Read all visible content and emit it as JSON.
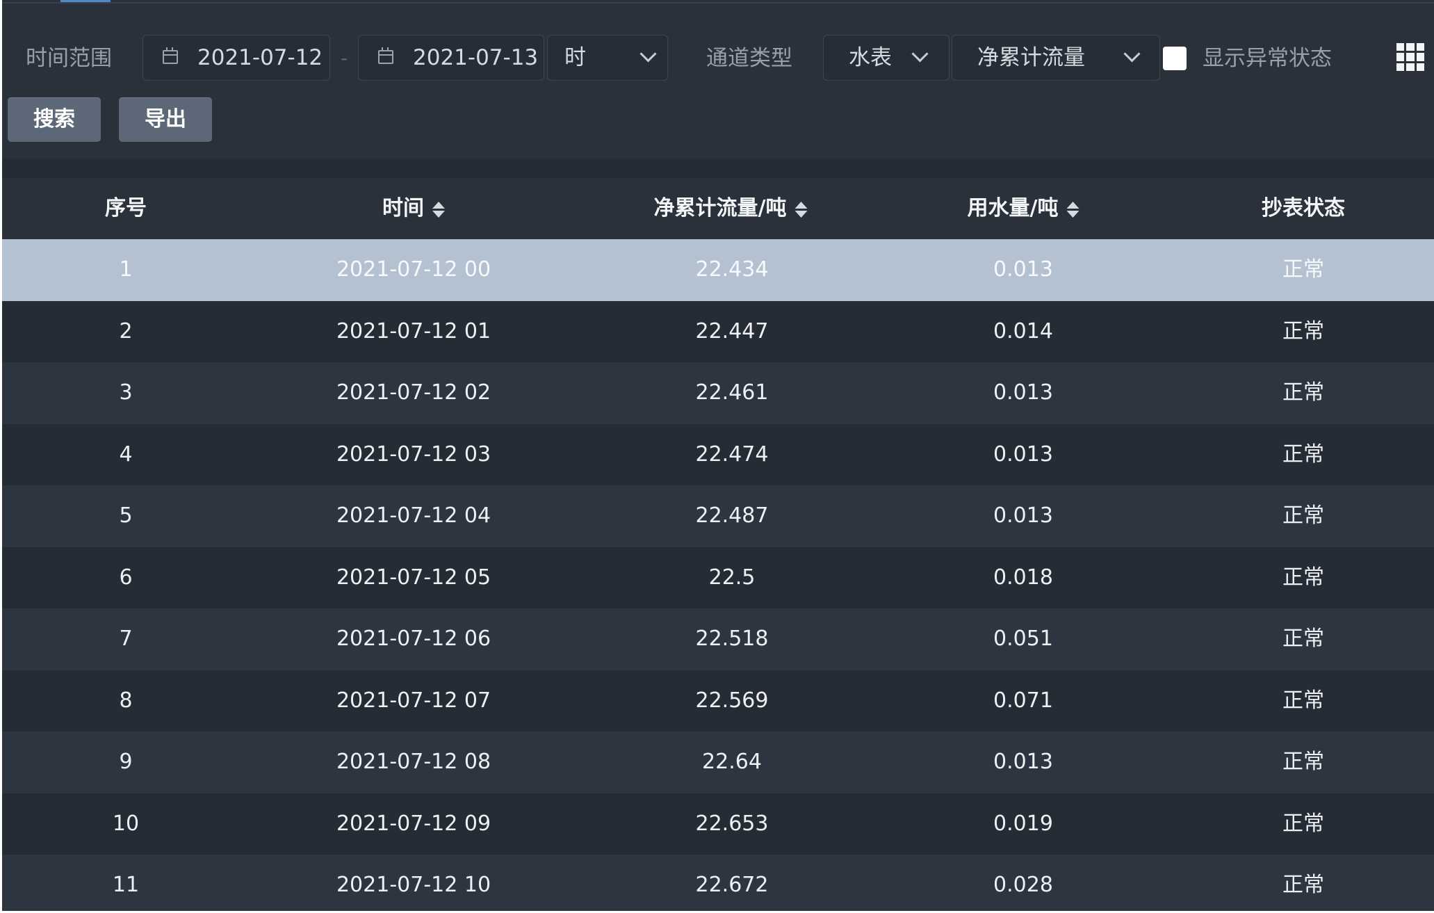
{
  "filters": {
    "time_range_label": "时间范围",
    "start_date": "2021-07-12",
    "separator": "-",
    "end_date": "2021-07-13",
    "granularity": "时",
    "channel_type_label": "通道类型",
    "channel_type": "水表",
    "metric": "净累计流量",
    "show_abnormal_label": "显示异常状态",
    "show_abnormal_checked": false
  },
  "buttons": {
    "search": "搜索",
    "export": "导出"
  },
  "table": {
    "columns": [
      "序号",
      "时间",
      "净累计流量/吨",
      "用水量/吨",
      "抄表状态"
    ],
    "rows": [
      {
        "index": "1",
        "time": "2021-07-12 00",
        "net_flow": "22.434",
        "usage": "0.013",
        "status": "正常"
      },
      {
        "index": "2",
        "time": "2021-07-12 01",
        "net_flow": "22.447",
        "usage": "0.014",
        "status": "正常"
      },
      {
        "index": "3",
        "time": "2021-07-12 02",
        "net_flow": "22.461",
        "usage": "0.013",
        "status": "正常"
      },
      {
        "index": "4",
        "time": "2021-07-12 03",
        "net_flow": "22.474",
        "usage": "0.013",
        "status": "正常"
      },
      {
        "index": "5",
        "time": "2021-07-12 04",
        "net_flow": "22.487",
        "usage": "0.013",
        "status": "正常"
      },
      {
        "index": "6",
        "time": "2021-07-12 05",
        "net_flow": "22.5",
        "usage": "0.018",
        "status": "正常"
      },
      {
        "index": "7",
        "time": "2021-07-12 06",
        "net_flow": "22.518",
        "usage": "0.051",
        "status": "正常"
      },
      {
        "index": "8",
        "time": "2021-07-12 07",
        "net_flow": "22.569",
        "usage": "0.071",
        "status": "正常"
      },
      {
        "index": "9",
        "time": "2021-07-12 08",
        "net_flow": "22.64",
        "usage": "0.013",
        "status": "正常"
      },
      {
        "index": "10",
        "time": "2021-07-12 09",
        "net_flow": "22.653",
        "usage": "0.019",
        "status": "正常"
      },
      {
        "index": "11",
        "time": "2021-07-12 10",
        "net_flow": "22.672",
        "usage": "0.028",
        "status": "正常"
      }
    ]
  },
  "colors": {
    "background": "#2a313b",
    "selected_row": "#b4c1d1",
    "button": "#5c6878",
    "accent": "#4f87c9"
  }
}
